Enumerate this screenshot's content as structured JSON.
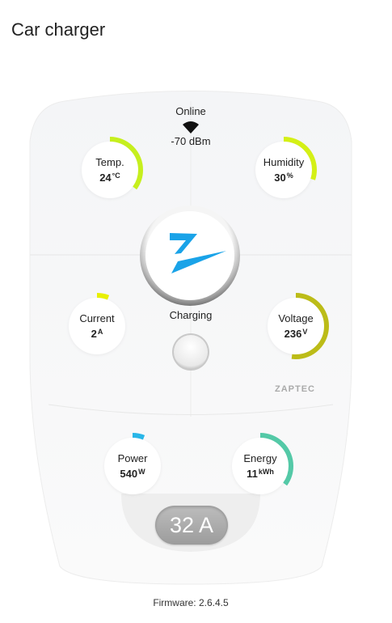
{
  "card_title": "Car charger",
  "status": {
    "online": "Online",
    "signal": "-70 dBm",
    "state": "Charging"
  },
  "gauges": {
    "temp": {
      "label": "Temp.",
      "value": "24",
      "unit": "°C",
      "color": "#c6ef1e",
      "level": 0.35
    },
    "humidity": {
      "label": "Humidity",
      "value": "30",
      "unit": "%",
      "color": "#d4f016",
      "level": 0.3
    },
    "current": {
      "label": "Current",
      "value": "2",
      "unit": "A",
      "color": "#e8f000",
      "level": 0.06
    },
    "voltage": {
      "label": "Voltage",
      "value": "236",
      "unit": "V",
      "color": "#bcbc18",
      "level": 0.52
    },
    "power": {
      "label": "Power",
      "value": "540",
      "unit": "W",
      "color": "#29b6e8",
      "level": 0.06
    },
    "energy": {
      "label": "Energy",
      "value": "11",
      "unit": "kWh",
      "color": "#54c9a7",
      "level": 0.35
    }
  },
  "brand": "ZAPTEC",
  "amp_button": "32 A",
  "firmware": "Firmware: 2.6.4.5",
  "icons": {
    "wifi": "wifi-icon",
    "logo": "zaptec-z-logo"
  }
}
